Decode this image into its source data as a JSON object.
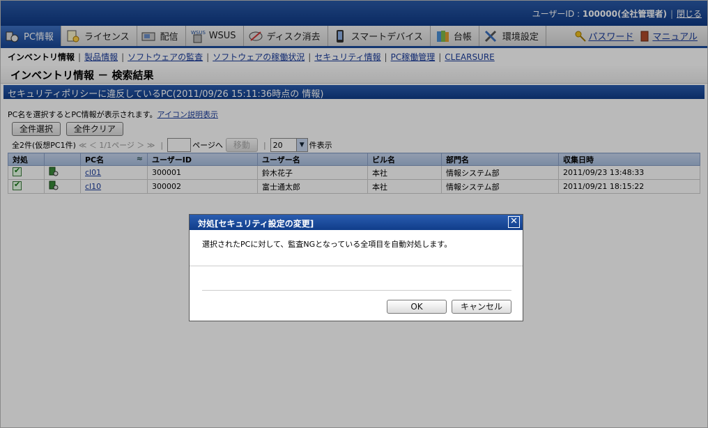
{
  "header": {
    "user_label": "ユーザーID : ",
    "user_id": "100000(全社管理者)",
    "close": "閉じる"
  },
  "tabs": [
    {
      "label": "PC情報",
      "icon": "pc-icon"
    },
    {
      "label": "ライセンス",
      "icon": "license-icon"
    },
    {
      "label": "配信",
      "icon": "deliver-icon"
    },
    {
      "label": "WSUS",
      "icon": "wsus-icon"
    },
    {
      "label": "ディスク消去",
      "icon": "disk-erase-icon"
    },
    {
      "label": "スマートデバイス",
      "icon": "smart-device-icon"
    },
    {
      "label": "台帳",
      "icon": "ledger-icon"
    },
    {
      "label": "環境設定",
      "icon": "settings-icon"
    }
  ],
  "tab_right": {
    "password": "パスワード",
    "manual": "マニュアル"
  },
  "subnav": {
    "current": "インベントリ情報",
    "links": [
      "製品情報",
      "ソフトウェアの監査",
      "ソフトウェアの稼働状況",
      "セキュリティ情報",
      "PC稼働管理",
      "CLEARSURE"
    ]
  },
  "page_title": "インベントリ情報 － 検索結果",
  "section_title": "セキュリティポリシーに違反しているPC(2011/09/26 15:11:36時点の 情報)",
  "info": {
    "text": "PC名を選択するとPC情報が表示されます。",
    "link": "アイコン説明表示"
  },
  "buttons": {
    "select_all": "全件選択",
    "clear_all": "全件クリア"
  },
  "pager": {
    "count": "全2件(仮想PC1件)",
    "nav": "≪ ＜ 1/1ページ ＞ ≫",
    "page_suffix": "ページへ",
    "move": "移動",
    "per_page": "20",
    "per_page_suffix": "件表示"
  },
  "table": {
    "headers": [
      "対処",
      "",
      "PC名",
      "ユーザーID",
      "ユーザー名",
      "ビル名",
      "部門名",
      "収集日時"
    ],
    "sort_mark": "≈",
    "rows": [
      {
        "pc": "cl01",
        "user_id": "300001",
        "user_name": "鈴木花子",
        "building": "本社",
        "dept": "情報システム部",
        "date": "2011/09/23 13:48:33"
      },
      {
        "pc": "cl10",
        "user_id": "300002",
        "user_name": "富士通太郎",
        "building": "本社",
        "dept": "情報システム部",
        "date": "2011/09/21 18:15:22"
      }
    ]
  },
  "dialog": {
    "title": "対処[セキュリティ設定の変更]",
    "message": "選択されたPCに対して、監査NGとなっている全項目を自動対処します。",
    "ok": "OK",
    "cancel": "キャンセル",
    "close_glyph": "✕"
  },
  "colors": {
    "header_blue": "#0f3a86",
    "grid_header": "#b4c8e6",
    "link": "#1a3c9c"
  }
}
